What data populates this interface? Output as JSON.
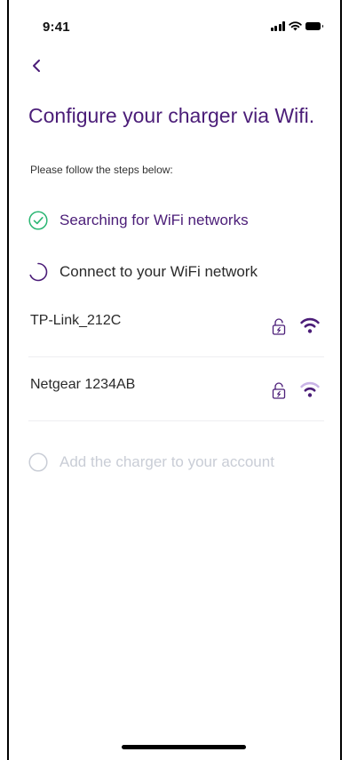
{
  "status_bar": {
    "time": "9:41"
  },
  "header": {
    "title": "Configure your charger via Wifi.",
    "subtitle": "Please follow the steps below:"
  },
  "steps": [
    {
      "label": "Searching for WiFi networks",
      "state": "done",
      "icon": "check-circle-icon"
    },
    {
      "label": "Connect to your WiFi network",
      "state": "in-progress",
      "icon": "spinner-icon"
    },
    {
      "label": "Add the charger to your account",
      "state": "pending",
      "icon": "empty-circle-icon"
    }
  ],
  "networks": [
    {
      "name": "TP-Link_212C",
      "secured": true,
      "signal": "strong"
    },
    {
      "name": "Netgear 1234AB",
      "secured": true,
      "signal": "weak"
    }
  ],
  "colors": {
    "accent": "#4b1d78",
    "success": "#2bb673",
    "disabled": "#c9cdd6",
    "wifi_weak": "#c9b3e6"
  }
}
